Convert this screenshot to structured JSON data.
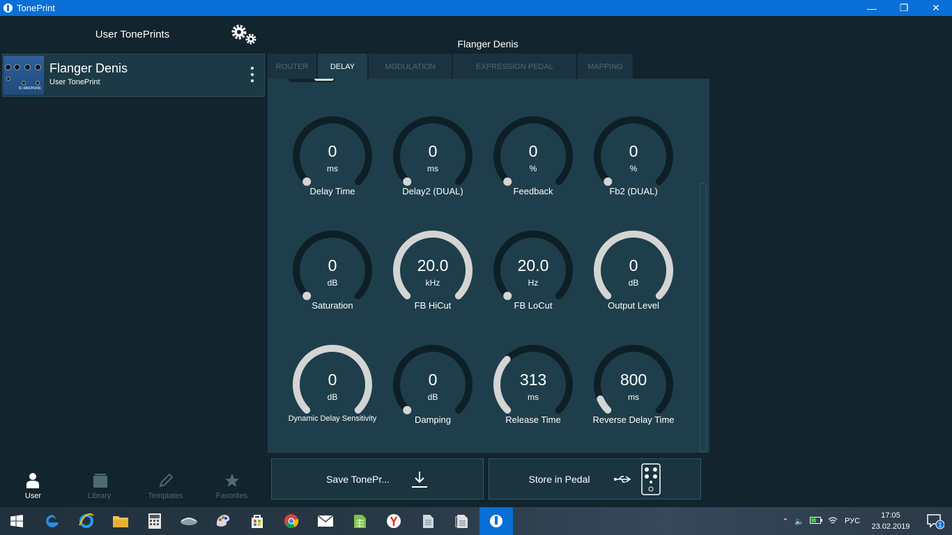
{
  "window": {
    "title": "TonePrint",
    "minimize": "—",
    "restore": "❐",
    "close": "✕"
  },
  "sidebar": {
    "header": "User TonePrints",
    "item": {
      "name": "Flanger Denis",
      "subtitle": "User TonePrint",
      "thumb_brand": "tc electronic"
    },
    "nav": [
      {
        "label": "User",
        "icon": "user-icon",
        "active": true
      },
      {
        "label": "Library",
        "icon": "library-icon",
        "active": false
      },
      {
        "label": "Templates",
        "icon": "pencil-icon",
        "active": false
      },
      {
        "label": "Favorites",
        "icon": "star-icon",
        "active": false
      }
    ]
  },
  "editor": {
    "preset_title": "Flanger Denis",
    "tabs": [
      {
        "label": "ROUTER",
        "active": false
      },
      {
        "label": "DELAY",
        "active": true
      },
      {
        "label": "MODULATION",
        "active": false
      },
      {
        "label": "EXPRESSION PEDAL",
        "active": false
      },
      {
        "label": "MAPPING",
        "active": false
      }
    ],
    "knobs": [
      {
        "value": "0",
        "unit": "ms",
        "label": "Delay Time",
        "level": 0
      },
      {
        "value": "0",
        "unit": "ms",
        "label": "Delay2 (DUAL)",
        "level": 0
      },
      {
        "value": "0",
        "unit": "%",
        "label": "Feedback",
        "level": 0
      },
      {
        "value": "0",
        "unit": "%",
        "label": "Fb2 (DUAL)",
        "level": 0
      },
      {
        "value": "0",
        "unit": "dB",
        "label": "Saturation",
        "level": 0
      },
      {
        "value": "20.0",
        "unit": "kHz",
        "label": "FB HiCut",
        "level": 1
      },
      {
        "value": "20.0",
        "unit": "Hz",
        "label": "FB LoCut",
        "level": 0
      },
      {
        "value": "0",
        "unit": "dB",
        "label": "Output Level",
        "level": 1
      },
      {
        "value": "0",
        "unit": "dB",
        "label": "Dynamic Delay Sensitivity",
        "level": 1
      },
      {
        "value": "0",
        "unit": "dB",
        "label": "Damping",
        "level": 0
      },
      {
        "value": "313",
        "unit": "ms",
        "label": "Release Time",
        "level": 0.33
      },
      {
        "value": "800",
        "unit": "ms",
        "label": "Reverse Delay Time",
        "level": 0.08
      }
    ],
    "actions": {
      "save": "Save TonePr...",
      "store": "Store in Pedal"
    }
  },
  "colors": {
    "accent": "#0a6fd6",
    "panel": "#1e3e4b",
    "background": "#12242d",
    "knob_track": "#0e1f27",
    "knob_fill": "#d4d4d4"
  },
  "taskbar": {
    "apps": [
      "windows-start-icon",
      "edge-icon",
      "internet-explorer-icon",
      "file-explorer-icon",
      "calculator-icon",
      "app-icon",
      "paint-icon",
      "store-icon",
      "chrome-icon",
      "mail-icon",
      "spreadsheet-icon",
      "yandex-icon",
      "document-icon",
      "notes-icon",
      "toneprint-icon"
    ],
    "tray": {
      "language": "РУС",
      "time": "17:05",
      "date": "23.02.2019",
      "notifications": "1"
    }
  }
}
